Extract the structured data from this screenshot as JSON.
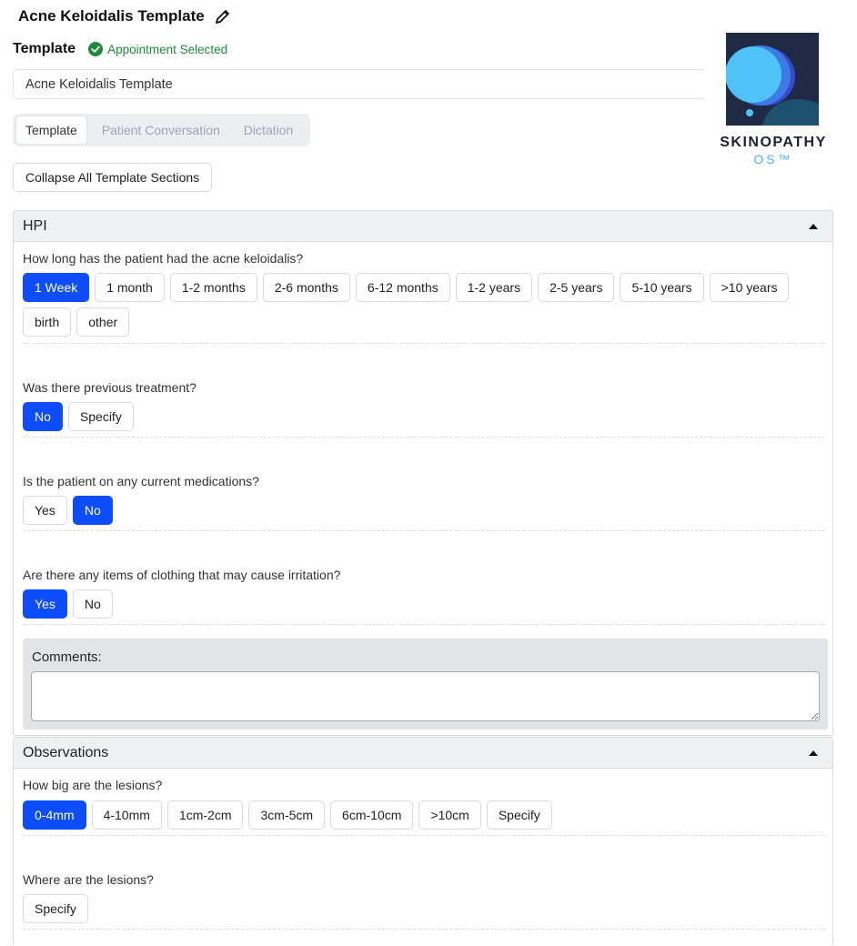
{
  "header": {
    "title": "Acne Keloidalis Template",
    "template_label": "Template",
    "appointment_status": "Appointment Selected",
    "template_name_value": "Acne Keloidalis Template"
  },
  "logo": {
    "brand": "SKINOPATHY",
    "suffix": "OS™"
  },
  "tabs": [
    {
      "label": "Template",
      "active": true
    },
    {
      "label": "Patient Conversation",
      "active": false
    },
    {
      "label": "Dictation",
      "active": false
    }
  ],
  "collapse_label": "Collapse All Template Sections",
  "hpi": {
    "title": "HPI",
    "questions": [
      {
        "text": "How long has the patient had the acne keloidalis?",
        "options": [
          "1 Week",
          "1 month",
          "1-2 months",
          "2-6 months",
          "6-12 months",
          "1-2 years",
          "2-5 years",
          "5-10 years",
          ">10 years",
          "birth",
          "other"
        ],
        "selected": "1 Week"
      },
      {
        "text": "Was there previous treatment?",
        "options": [
          "No",
          "Specify"
        ],
        "selected": "No"
      },
      {
        "text": "Is the patient on any current medications?",
        "options": [
          "Yes",
          "No"
        ],
        "selected": "No"
      },
      {
        "text": "Are there any items of clothing that may cause irritation?",
        "options": [
          "Yes",
          "No"
        ],
        "selected": "Yes"
      }
    ],
    "comments_label": "Comments:"
  },
  "observations": {
    "title": "Observations",
    "questions": [
      {
        "text": "How big are the lesions?",
        "options": [
          "0-4mm",
          "4-10mm",
          "1cm-2cm",
          "3cm-5cm",
          "6cm-10cm",
          ">10cm",
          "Specify"
        ],
        "selected": "0-4mm"
      },
      {
        "text": "Where are the lesions?",
        "options": [
          "Specify"
        ],
        "selected": ""
      }
    ]
  },
  "colors": {
    "accent": "#0d4dfc",
    "success": "#1f8a3a",
    "header_bg": "#eef0f2"
  }
}
